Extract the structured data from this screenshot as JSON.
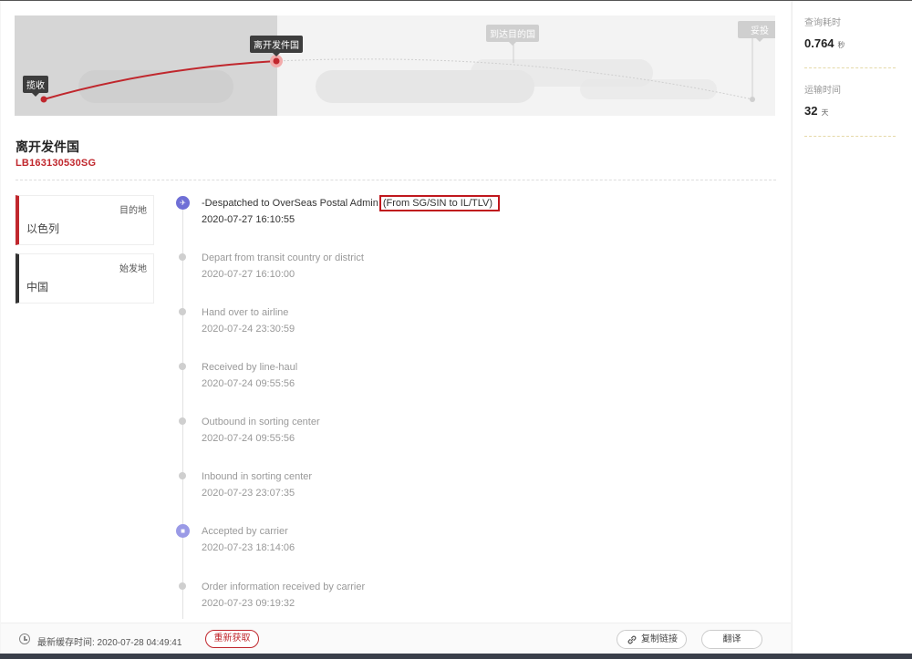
{
  "progress": {
    "stages": [
      {
        "label": "揽收",
        "state": "done"
      },
      {
        "label": "离开发件国",
        "state": "current"
      },
      {
        "label": "到达目的国",
        "state": "pending"
      },
      {
        "label": "妥投",
        "state": "pending"
      }
    ],
    "colors": {
      "active": "#c0272d",
      "pending": "#cfcfcf"
    }
  },
  "shipment": {
    "status_title": "离开发件国",
    "tracking_number": "LB163130530SG"
  },
  "destination": {
    "role": "目的地",
    "country": "以色列"
  },
  "origin": {
    "role": "始发地",
    "country": "中国"
  },
  "events": [
    {
      "icon": "plane-icon",
      "desc_main": "-Despatched to OverSeas Postal Admin",
      "desc_highlight": "(From SG/SIN to IL/TLV)",
      "time": "2020-07-27 16:10:55"
    },
    {
      "icon": "dot",
      "desc": "Depart from transit country or district",
      "time": "2020-07-27 16:10:00"
    },
    {
      "icon": "dot",
      "desc": "Hand over to airline",
      "time": "2020-07-24 23:30:59"
    },
    {
      "icon": "dot",
      "desc": "Received by line-haul",
      "time": "2020-07-24 09:55:56"
    },
    {
      "icon": "dot",
      "desc": "Outbound in sorting center",
      "time": "2020-07-24 09:55:56"
    },
    {
      "icon": "dot",
      "desc": "Inbound in sorting center",
      "time": "2020-07-23 23:07:35"
    },
    {
      "icon": "truck-icon",
      "desc": "Accepted by carrier",
      "time": "2020-07-23 18:14:06"
    },
    {
      "icon": "dot",
      "desc": "Order information received by carrier",
      "time": "2020-07-23 09:19:32"
    }
  ],
  "footer": {
    "cache_text": "最新缓存时间: 2020-07-28 04:49:41",
    "refresh_label": "重新获取",
    "copy_label": "复制链接",
    "translate_label": "翻译"
  },
  "stats": {
    "query_label": "查询耗时",
    "query_value": "0.764",
    "query_unit": "秒",
    "transit_label": "运输时间",
    "transit_value": "32",
    "transit_unit": "天"
  }
}
